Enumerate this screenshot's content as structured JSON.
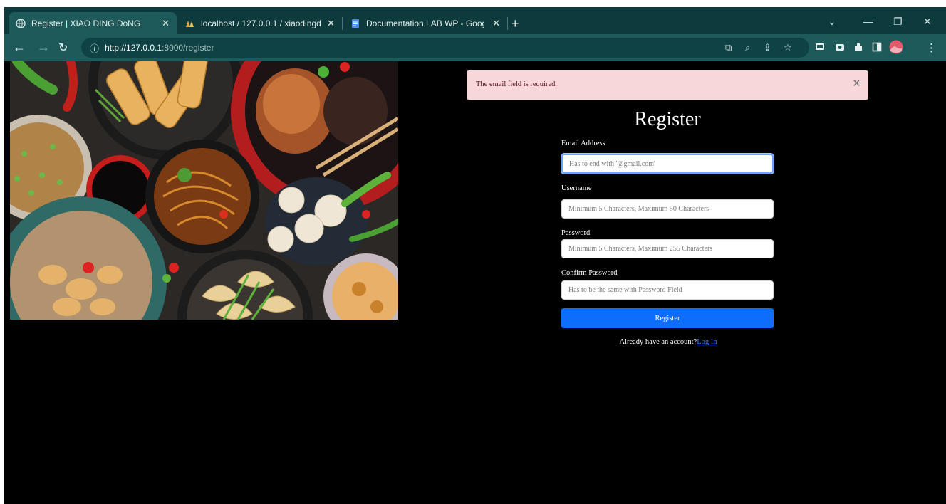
{
  "browser": {
    "tabs": [
      {
        "title": "Register | XIAO DING DoNG",
        "active": true
      },
      {
        "title": "localhost / 127.0.0.1 / xiaodingd",
        "active": false
      },
      {
        "title": "Documentation LAB WP - Goog",
        "active": false
      }
    ],
    "new_tab": "+",
    "url_host": "http://127.0.0.1",
    "url_path": ":8000/register"
  },
  "alert": {
    "message": "The email field is required.",
    "close": "×"
  },
  "form": {
    "title": "Register",
    "email_label": "Email Address",
    "email_placeholder": "Has to end with '@gmail.com'",
    "username_label": "Username",
    "username_placeholder": "Minimum 5 Characters, Maximum 50 Characters",
    "password_label": "Password",
    "password_placeholder": "Minimum 5 Characters, Maximum 255 Characters",
    "confirm_label": "Confirm Password",
    "confirm_placeholder": "Has to be the same with Password Field",
    "submit_label": "Register",
    "already_text": "Already have an account?",
    "login_link": "Log In"
  },
  "colors": {
    "alert_bg": "#f8d7da",
    "primary": "#0d6efd",
    "tab_bar": "#0d3a3c",
    "toolbar": "#1f5a5b"
  }
}
